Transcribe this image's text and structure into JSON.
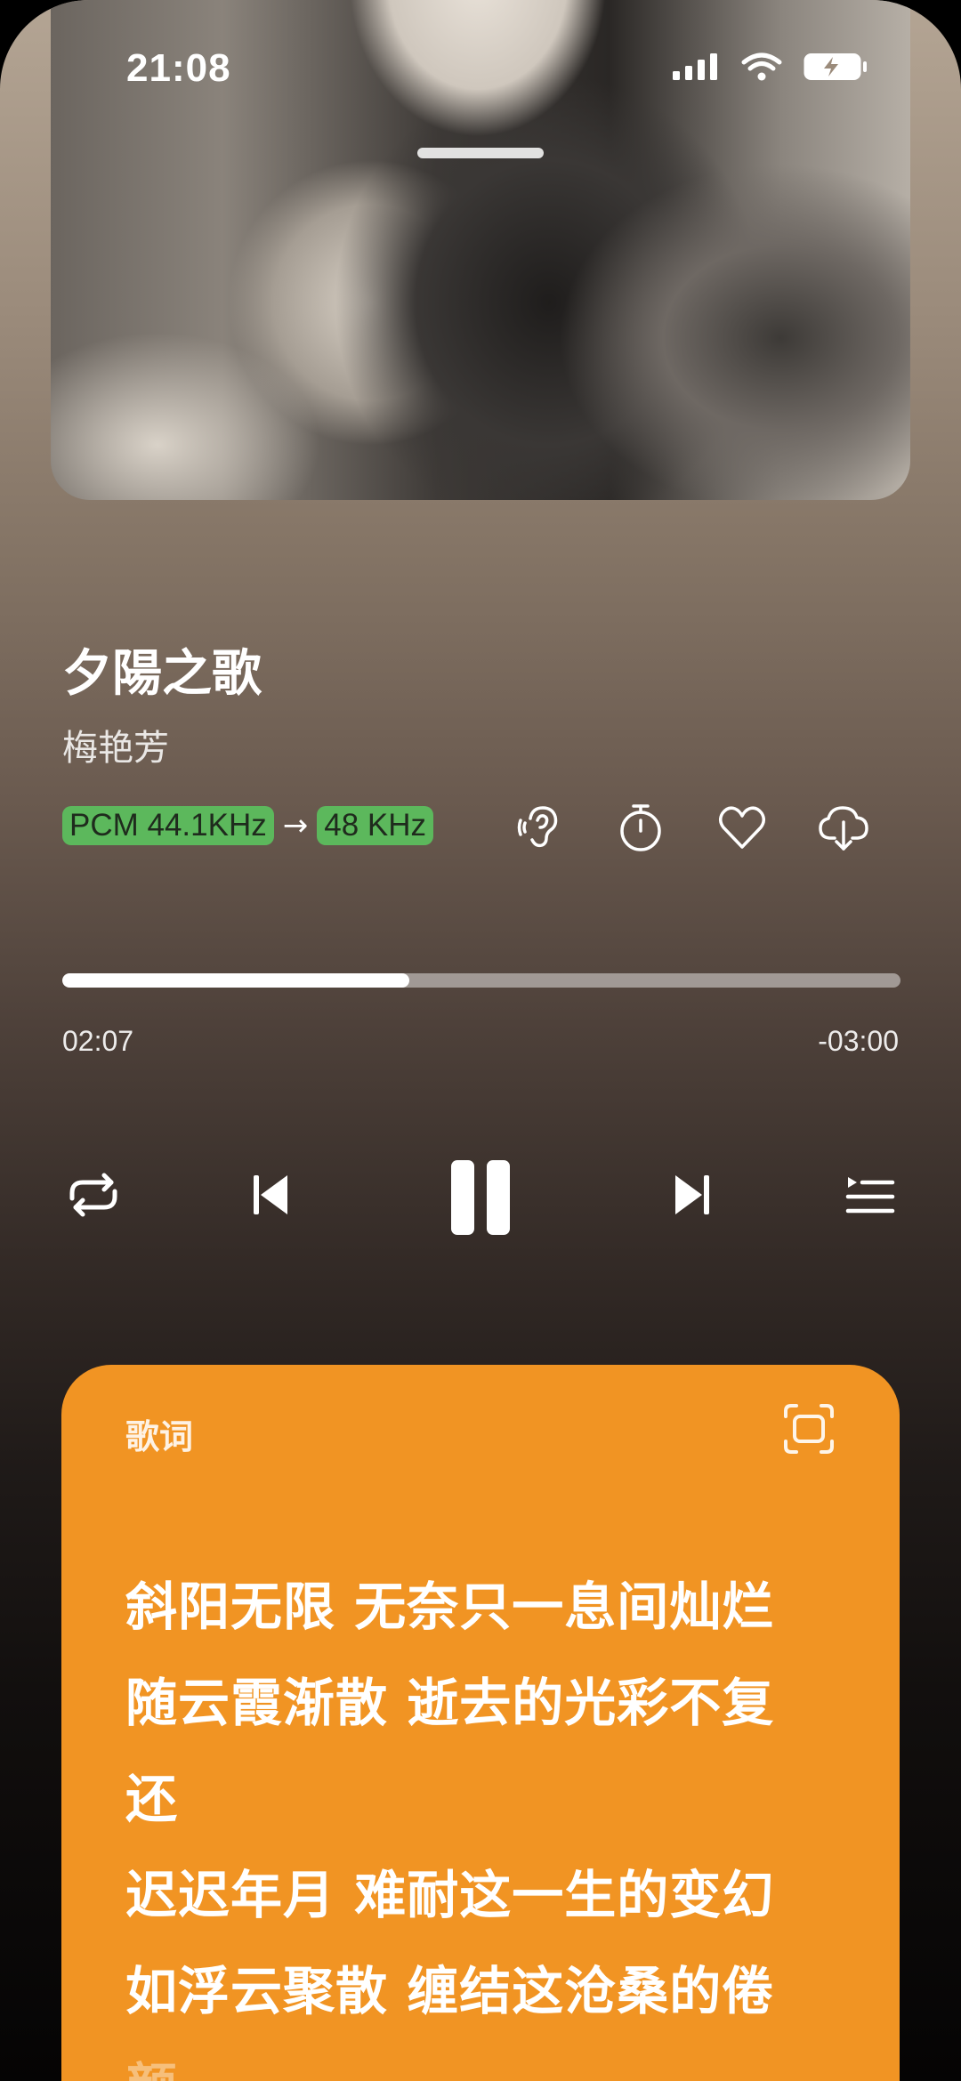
{
  "status_bar": {
    "time": "21:08",
    "signal_icon": "cellular-signal-icon",
    "wifi_icon": "wifi-icon",
    "battery_icon": "battery-charging-icon"
  },
  "song": {
    "title": "夕陽之歌",
    "artist": "梅艳芳"
  },
  "audio_format": {
    "source": "PCM 44.1KHz",
    "arrow": "→",
    "output": "48 KHz"
  },
  "actions": [
    {
      "name": "ear-icon"
    },
    {
      "name": "timer-icon"
    },
    {
      "name": "heart-icon"
    },
    {
      "name": "download-icon"
    }
  ],
  "progress": {
    "elapsed": "02:07",
    "remaining": "-03:00",
    "fraction": 0.414
  },
  "transport": {
    "repeat": "repeat-icon",
    "previous": "previous-icon",
    "play_pause": "pause-icon",
    "next": "next-icon",
    "queue": "queue-icon"
  },
  "lyrics": {
    "label": "歌词",
    "lines": [
      "斜阳无限 无奈只一息间灿烂",
      "随云霞渐散 逝去的光彩不复",
      "还",
      "迟迟年月 难耐这一生的变幻",
      "如浮云聚散 缠结这沧桑的倦",
      "颜"
    ]
  },
  "colors": {
    "accent": "#f19423",
    "badge_green": "#5cb85c"
  }
}
